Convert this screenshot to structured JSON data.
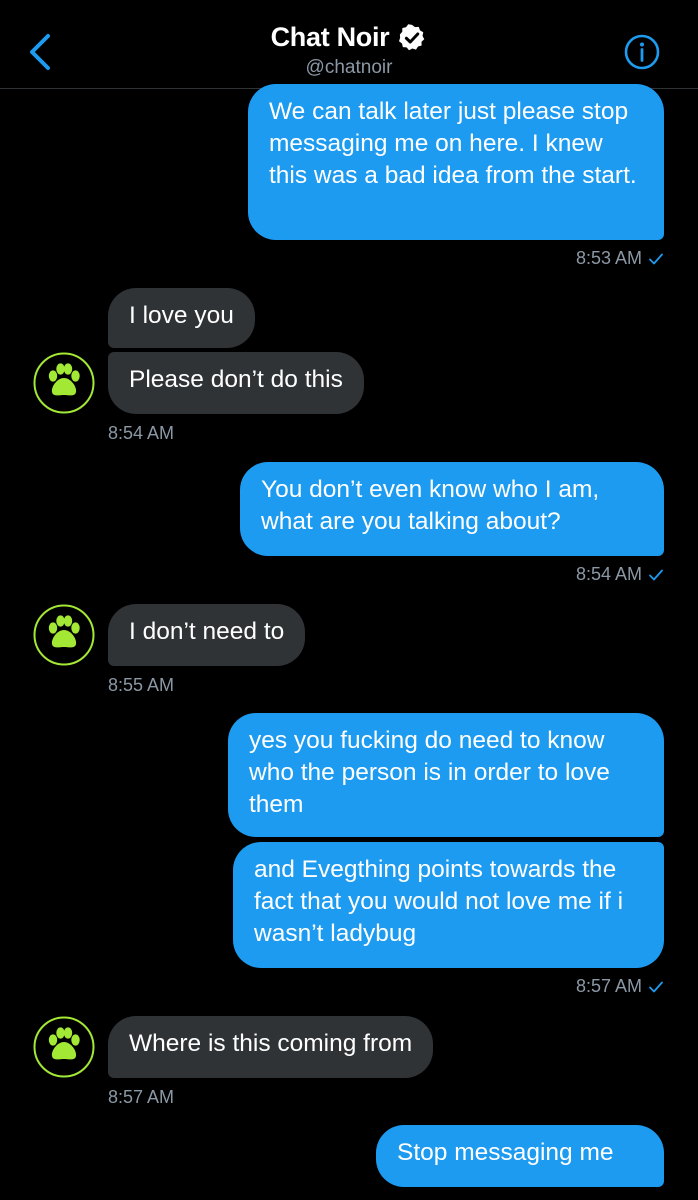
{
  "header": {
    "title": "Chat Noir",
    "handle": "@chatnoir"
  },
  "colors": {
    "accent": "#1d9bf0",
    "incoming_bubble": "#2f3336",
    "timestamp": "#8b98a5",
    "avatar_green": "#a4e836"
  },
  "icons": {
    "back": "chevron-left-icon",
    "verified": "verified-badge-icon",
    "info": "info-icon",
    "avatar": "paw-print-icon",
    "read": "checkmark-icon"
  },
  "messages": [
    {
      "from": "me",
      "text": "We can talk later just please stop messaging me on here. I knew this was a bad idea from the start."
    },
    {
      "meta": "8:53 AM"
    },
    {
      "from": "them",
      "text": "I love you"
    },
    {
      "from": "them",
      "text": "Please don’t do this"
    },
    {
      "meta": "8:54 AM"
    },
    {
      "from": "me",
      "text": "You don’t even know who I am, what are you talking about?"
    },
    {
      "meta": "8:54 AM"
    },
    {
      "from": "them",
      "text": "I don’t need to"
    },
    {
      "meta": "8:55 AM"
    },
    {
      "from": "me",
      "text": "yes you fucking  do need to know who the person is in order to love them"
    },
    {
      "from": "me",
      "text": "and Evegthing points towards the fact that you would not love me if i wasn’t ladybug"
    },
    {
      "meta": "8:57 AM"
    },
    {
      "from": "them",
      "text": "Where is this coming from"
    },
    {
      "meta": "8:57 AM"
    },
    {
      "from": "me",
      "text": "Stop messaging me"
    }
  ]
}
